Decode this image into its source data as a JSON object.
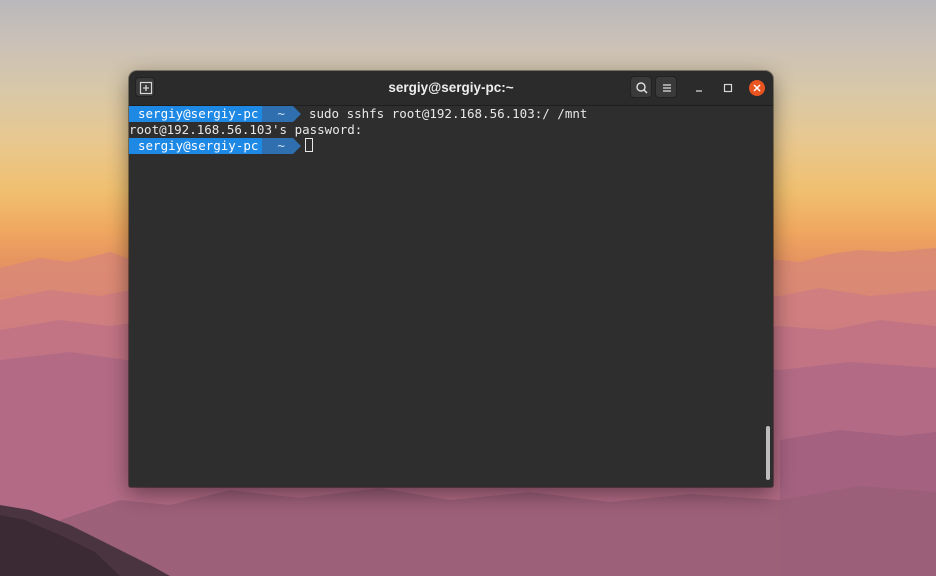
{
  "window": {
    "title": "sergiy@sergiy-pc:~"
  },
  "terminal": {
    "prompt_user": "sergiy@sergiy-pc",
    "prompt_dir": "~",
    "command": "sudo sshfs root@192.168.56.103:/ /mnt",
    "output": "root@192.168.56.103's password:"
  },
  "icons": {
    "new_tab": "new-tab-icon",
    "search": "search-icon",
    "menu": "hamburger-menu-icon",
    "minimize": "minimize-icon",
    "maximize": "maximize-icon",
    "close": "close-icon"
  },
  "colors": {
    "prompt_user_bg": "#1e88e5",
    "prompt_dir_bg": "#2f6fb0",
    "terminal_bg": "#2e2e2e",
    "close_button": "#e95420"
  }
}
